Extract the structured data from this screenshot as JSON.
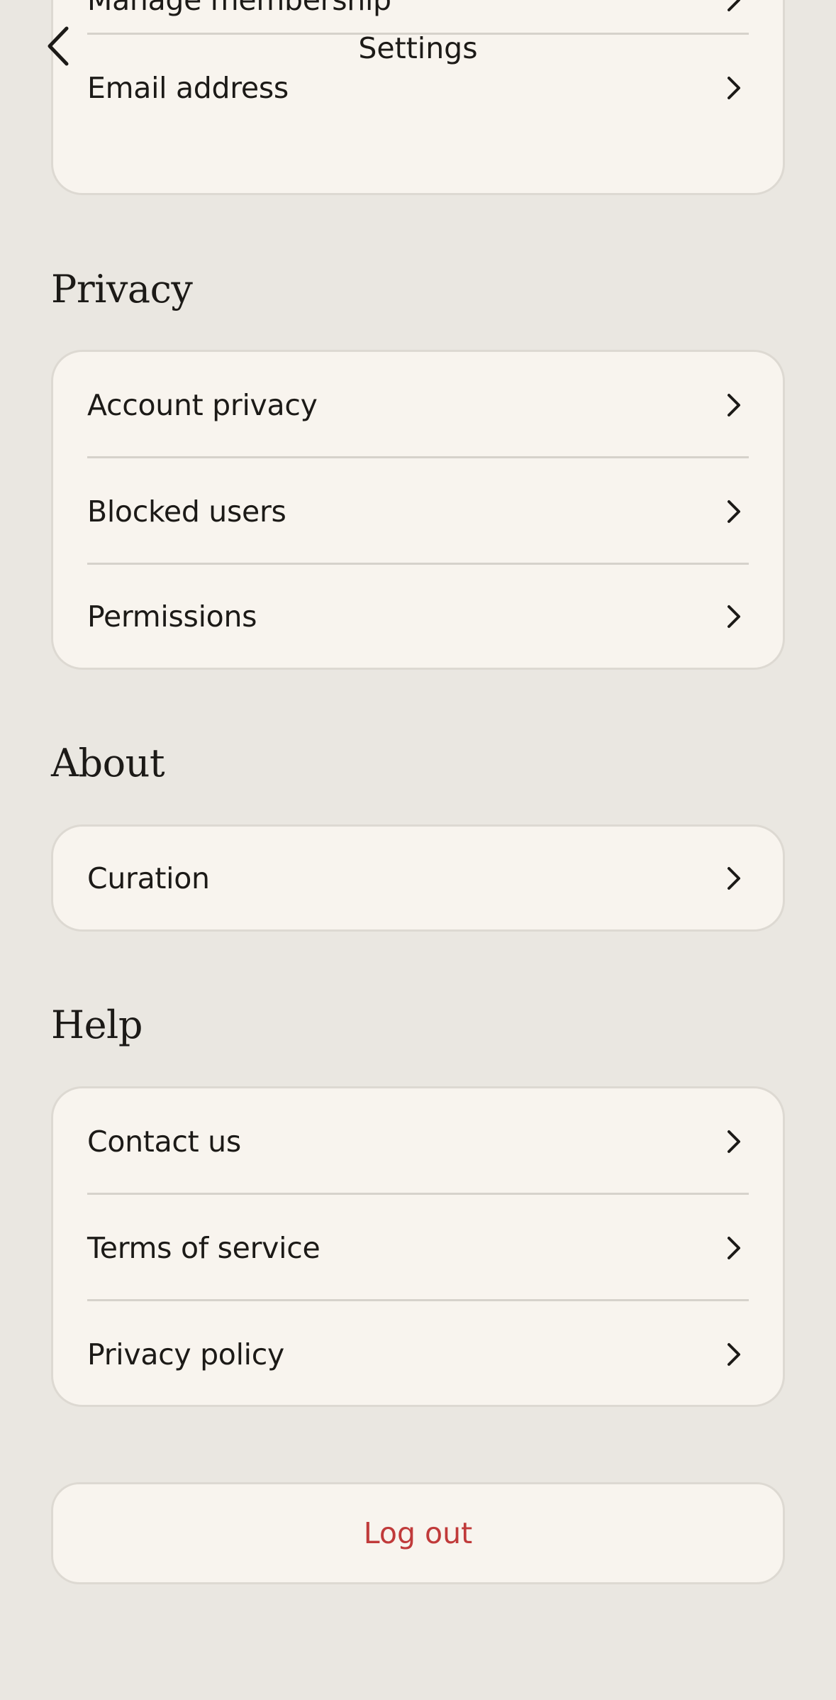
{
  "header": {
    "title": "Settings",
    "back_icon": "chevron-left-icon"
  },
  "account": {
    "items": [
      {
        "label": "Manage membership"
      },
      {
        "label": "Email address"
      }
    ]
  },
  "privacy": {
    "title": "Privacy",
    "items": [
      {
        "label": "Account privacy"
      },
      {
        "label": "Blocked users"
      },
      {
        "label": "Permissions"
      }
    ]
  },
  "about": {
    "title": "About",
    "items": [
      {
        "label": "Curation"
      }
    ]
  },
  "help": {
    "title": "Help",
    "items": [
      {
        "label": "Contact us"
      },
      {
        "label": "Terms of service"
      },
      {
        "label": "Privacy policy"
      }
    ]
  },
  "logout": {
    "label": "Log out"
  },
  "colors": {
    "background": "#EAE7E1",
    "card": "#F8F4EE",
    "text": "#1C1A17",
    "danger": "#C03A3A"
  }
}
